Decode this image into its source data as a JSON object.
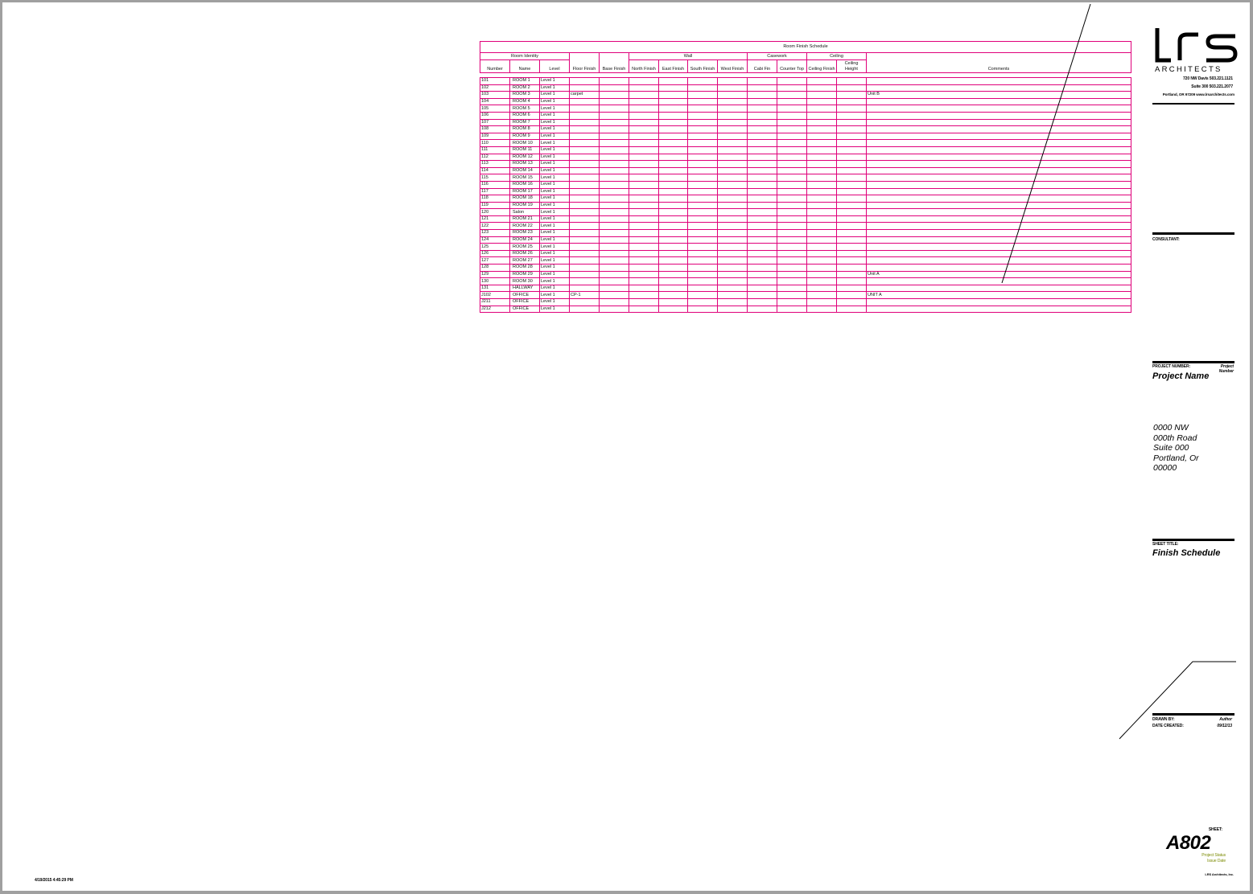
{
  "schedule": {
    "title": "Room Finish Schedule",
    "groups": {
      "room_identity": "Room Identity",
      "wall": "Wall",
      "casework": "Casework",
      "ceiling": "Ceiling"
    },
    "columns": {
      "number": "Number",
      "name": "Name",
      "level": "Level",
      "floor_finish": "Floor Finish",
      "base_finish": "Base Finish",
      "north_finish": "North Finish",
      "east_finish": "East Finish",
      "south_finish": "South Finish",
      "west_finish": "West Finish",
      "cabinet": "Cabi Fin",
      "counter_top": "Counter Top",
      "ceiling_finish": "Ceiling Finish",
      "ceiling_height": "Ceiling Height",
      "comments": "Comments"
    },
    "rows": [
      {
        "number": "101",
        "name": "ROOM 1",
        "level": "Level 1",
        "floor": "",
        "comments": ""
      },
      {
        "number": "102",
        "name": "ROOM 2",
        "level": "Level 1",
        "floor": "",
        "comments": ""
      },
      {
        "number": "103",
        "name": "ROOM 3",
        "level": "Level 1",
        "floor": "carpet",
        "comments": "Unit B"
      },
      {
        "number": "104",
        "name": "ROOM 4",
        "level": "Level 1",
        "floor": "",
        "comments": ""
      },
      {
        "number": "105",
        "name": "ROOM 5",
        "level": "Level 1",
        "floor": "",
        "comments": ""
      },
      {
        "number": "106",
        "name": "ROOM 6",
        "level": "Level 1",
        "floor": "",
        "comments": ""
      },
      {
        "number": "107",
        "name": "ROOM 7",
        "level": "Level 1",
        "floor": "",
        "comments": ""
      },
      {
        "number": "108",
        "name": "ROOM 8",
        "level": "Level 1",
        "floor": "",
        "comments": ""
      },
      {
        "number": "109",
        "name": "ROOM 9",
        "level": "Level 1",
        "floor": "",
        "comments": ""
      },
      {
        "number": "110",
        "name": "ROOM 10",
        "level": "Level 1",
        "floor": "",
        "comments": ""
      },
      {
        "number": "111",
        "name": "ROOM 11",
        "level": "Level 1",
        "floor": "",
        "comments": ""
      },
      {
        "number": "112",
        "name": "ROOM 12",
        "level": "Level 1",
        "floor": "",
        "comments": ""
      },
      {
        "number": "113",
        "name": "ROOM 13",
        "level": "Level 1",
        "floor": "",
        "comments": ""
      },
      {
        "number": "114",
        "name": "ROOM 14",
        "level": "Level 1",
        "floor": "",
        "comments": ""
      },
      {
        "number": "115",
        "name": "ROOM 15",
        "level": "Level 1",
        "floor": "",
        "comments": ""
      },
      {
        "number": "116",
        "name": "ROOM 16",
        "level": "Level 1",
        "floor": "",
        "comments": ""
      },
      {
        "number": "117",
        "name": "ROOM 17",
        "level": "Level 1",
        "floor": "",
        "comments": ""
      },
      {
        "number": "118",
        "name": "ROOM 18",
        "level": "Level 1",
        "floor": "",
        "comments": ""
      },
      {
        "number": "119",
        "name": "ROOM 19",
        "level": "Level 1",
        "floor": "",
        "comments": ""
      },
      {
        "number": "120",
        "name": "Salon",
        "level": "Level 1",
        "floor": "",
        "comments": ""
      },
      {
        "number": "121",
        "name": "ROOM 21",
        "level": "Level 1",
        "floor": "",
        "comments": ""
      },
      {
        "number": "122",
        "name": "ROOM 22",
        "level": "Level 1",
        "floor": "",
        "comments": ""
      },
      {
        "number": "123",
        "name": "ROOM 23",
        "level": "Level 1",
        "floor": "",
        "comments": ""
      },
      {
        "number": "124",
        "name": "ROOM 24",
        "level": "Level 1",
        "floor": "",
        "comments": ""
      },
      {
        "number": "125",
        "name": "ROOM 25",
        "level": "Level 1",
        "floor": "",
        "comments": ""
      },
      {
        "number": "126",
        "name": "ROOM 26",
        "level": "Level 1",
        "floor": "",
        "comments": ""
      },
      {
        "number": "127",
        "name": "ROOM 27",
        "level": "Level 1",
        "floor": "",
        "comments": ""
      },
      {
        "number": "128",
        "name": "ROOM 28",
        "level": "Level 1",
        "floor": "",
        "comments": ""
      },
      {
        "number": "129",
        "name": "ROOM 29",
        "level": "Level 1",
        "floor": "",
        "comments": "Unit A"
      },
      {
        "number": "130",
        "name": "ROOM 30",
        "level": "Level 1",
        "floor": "",
        "comments": ""
      },
      {
        "number": "131",
        "name": "HALLWAY",
        "level": "Level 1",
        "floor": "",
        "comments": ""
      },
      {
        "number": "J102",
        "name": "OFFICE",
        "level": "Level 1",
        "floor": "CP-1",
        "comments": "UNIT A"
      },
      {
        "number": "J211",
        "name": "OFFICE",
        "level": "Level 1",
        "floor": "",
        "comments": ""
      },
      {
        "number": "J212",
        "name": "OFFICE",
        "level": "Level 1",
        "floor": "",
        "comments": ""
      }
    ]
  },
  "titleblock": {
    "logo_mark": "lrs",
    "logo_word": "ARCHITECTS",
    "office_line1": "720 NW Davis   503.221.1121",
    "office_line2": "Suite 300   503.221.2077",
    "office_line3": "Portland, OR 97209   www.lrsarchitects.com",
    "consultant_label": "CONSULTANT:",
    "project_number_label": "PROJECT NUMBER:",
    "project_number_value": "Project Number",
    "project_name": "Project Name",
    "project_address": "0000 NW\n000th Road\nSuite 000\nPortland, Or\n00000",
    "sheet_title_label": "SHEET TITLE:",
    "sheet_title": "Finish Schedule",
    "drawn_by_label": "DRAWN BY:",
    "drawn_by_value": "Author",
    "date_created_label": "DATE CREATED:",
    "date_created_value": "09/12/13",
    "sheet_label": "SHEET:",
    "sheet_number": "A802",
    "project_status_1": "Project Status",
    "project_status_2": "Issue Date",
    "copyright": "LRS Architects, Inc.",
    "plot_stamp": "4/19/2015 4:45:29 PM"
  },
  "colors": {
    "schedule_lines": "#e0007a",
    "status_text": "#7a8a00"
  }
}
